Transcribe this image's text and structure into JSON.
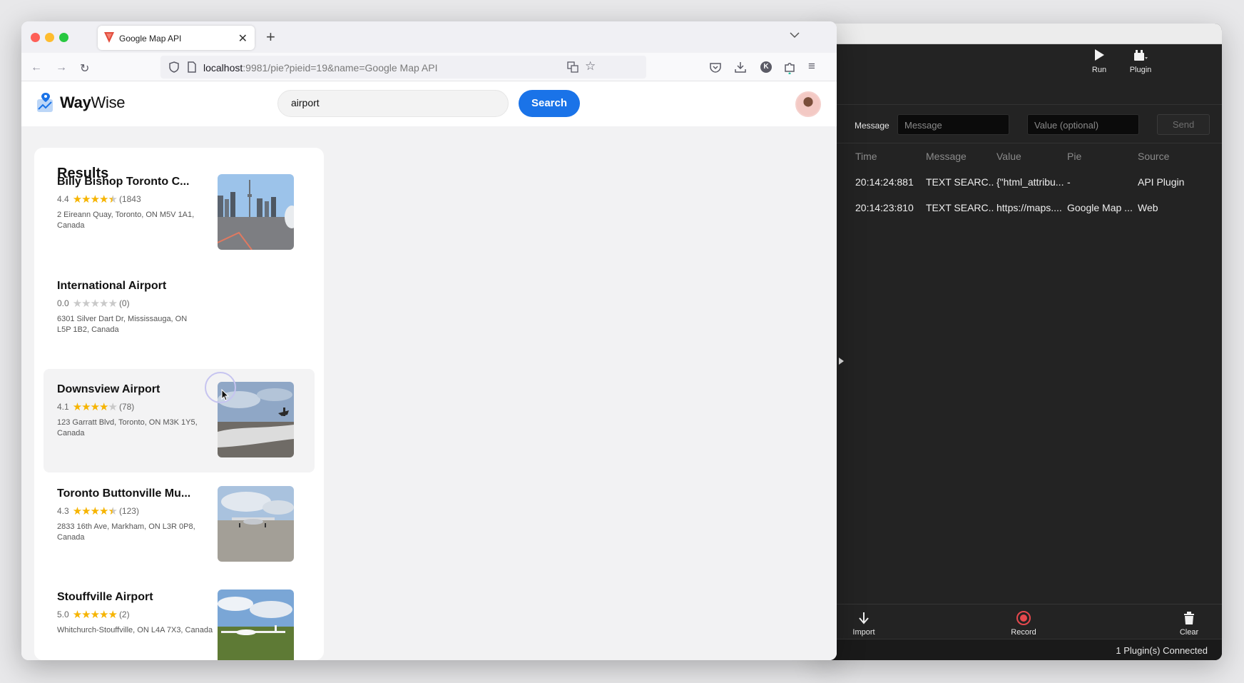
{
  "browser": {
    "tab_title": "Google Map API",
    "url_host": "localhost",
    "url_rest": ":9981/pie?pieid=19&name=Google Map API"
  },
  "app": {
    "brand_bold": "Way",
    "brand_rest": "Wise",
    "search_value": "airport",
    "search_button": "Search",
    "results_title": "Results",
    "results": [
      {
        "name": "Billy Bishop Toronto C...",
        "rating": "4.4",
        "stars": 4.5,
        "count": "(1843",
        "address": "2 Eireann Quay, Toronto, ON M5V 1A1, Canada",
        "image": "city-skyline-airport"
      },
      {
        "name": "International Airport",
        "rating": "0.0",
        "stars": 0,
        "count": "(0)",
        "address": "6301 Silver Dart Dr, Mississauga, ON L5P 1B2, Canada",
        "image": ""
      },
      {
        "name": "Downsview Airport",
        "rating": "4.1",
        "stars": 4,
        "count": "(78)",
        "address": "123 Garratt Blvd, Toronto, ON M3K 1Y5, Canada",
        "image": "snowy-airfield-plane"
      },
      {
        "name": "Toronto Buttonville Mu...",
        "rating": "4.3",
        "stars": 4.5,
        "count": "(123)",
        "address": "2833 16th Ave, Markham, ON L3R 0P8, Canada",
        "image": "parked-small-plane"
      },
      {
        "name": "Stouffville Airport",
        "rating": "5.0",
        "stars": 5,
        "count": "(2)",
        "address": "Whitchurch-Stouffville, ON L4A 7X3, Canada",
        "image": "grass-field-glider"
      }
    ]
  },
  "panel": {
    "run_label": "Run",
    "plugin_label": "Plugin",
    "message_label": "Message",
    "message_placeholder": "Message",
    "value_placeholder": "Value (optional)",
    "send_label": "Send",
    "columns": [
      "Time",
      "Message",
      "Value",
      "Pie",
      "Source"
    ],
    "rows": [
      [
        "20:14:24:881",
        "TEXT SEARC...",
        "{\"html_attribu...",
        "-",
        "API Plugin"
      ],
      [
        "20:14:23:810",
        "TEXT SEARC...",
        "https://maps....",
        "Google Map ...",
        "Web"
      ]
    ],
    "import_label": "Import",
    "record_label": "Record",
    "clear_label": "Clear",
    "status": "1 Plugin(s) Connected"
  },
  "colors": {
    "accent": "#1a73e8",
    "star": "#f6b400",
    "record": "#e5484d"
  }
}
